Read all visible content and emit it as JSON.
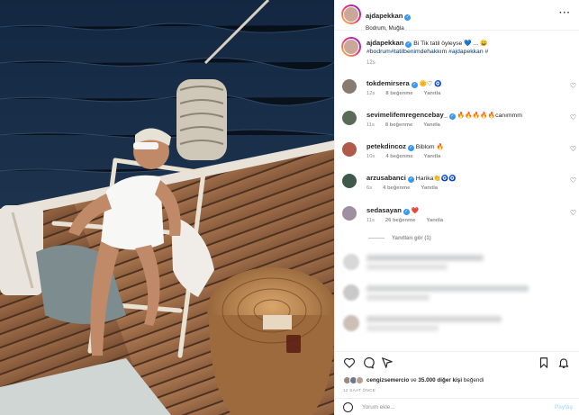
{
  "post": {
    "username": "ajdapekkan",
    "location": "Bodrum, Muğla",
    "more_icon": "more-horizontal-icon"
  },
  "caption": {
    "username": "ajdapekkan",
    "text": "Bi Tik tatil öyleyse 💙 ... 😀",
    "hashtags": "#bodrum#tatilbenimdehakkım #ajdapekkan #",
    "time": "12s"
  },
  "comments": [
    {
      "username": "tokdemirsera",
      "text": "🌼♡ 🧿",
      "time": "12s",
      "likes": "8 beğenme",
      "reply": "Yanıtla",
      "avatar_color": "#8a7b70"
    },
    {
      "username": "sevimelifemregencebay_",
      "text": "🔥🔥🔥🔥🔥canımmm",
      "time": "11s",
      "likes": "8 beğenme",
      "reply": "Yanıtla",
      "avatar_color": "#5a6b58"
    },
    {
      "username": "petekdincoz",
      "text": "Biblom 🔥",
      "time": "10s",
      "likes": "4 beğenme",
      "reply": "Yanıtla",
      "avatar_color": "#b05a4a"
    },
    {
      "username": "arzusabanci",
      "text": "Harika👏🧿🧿",
      "time": "6s",
      "likes": "4 beğenme",
      "reply": "Yanıtla",
      "avatar_color": "#3f5a4a"
    },
    {
      "username": "sedasayan",
      "text": "❤️",
      "time": "11s",
      "likes": "26 beğenme",
      "reply": "Yanıtla",
      "avatar_color": "#a08fa0"
    }
  ],
  "view_replies": "Yanıtları gör (1)",
  "actions": {
    "like_icon": "heart-icon",
    "comment_icon": "comment-icon",
    "share_icon": "send-icon",
    "save_icon": "bookmark-icon"
  },
  "likes": {
    "user": "cengizsemercio",
    "middle": " ve ",
    "others": "35.000 diğer kişi",
    "suffix": " beğendi"
  },
  "time_ago": "12 SAAT ÖNCE",
  "add_comment": {
    "placeholder": "Yorum ekle...",
    "post_label": "Paylaş"
  },
  "colors": {
    "link": "#00376b",
    "verified": "#3897f0",
    "muted": "#8e8e8e",
    "post_disabled": "#b2dffc"
  }
}
